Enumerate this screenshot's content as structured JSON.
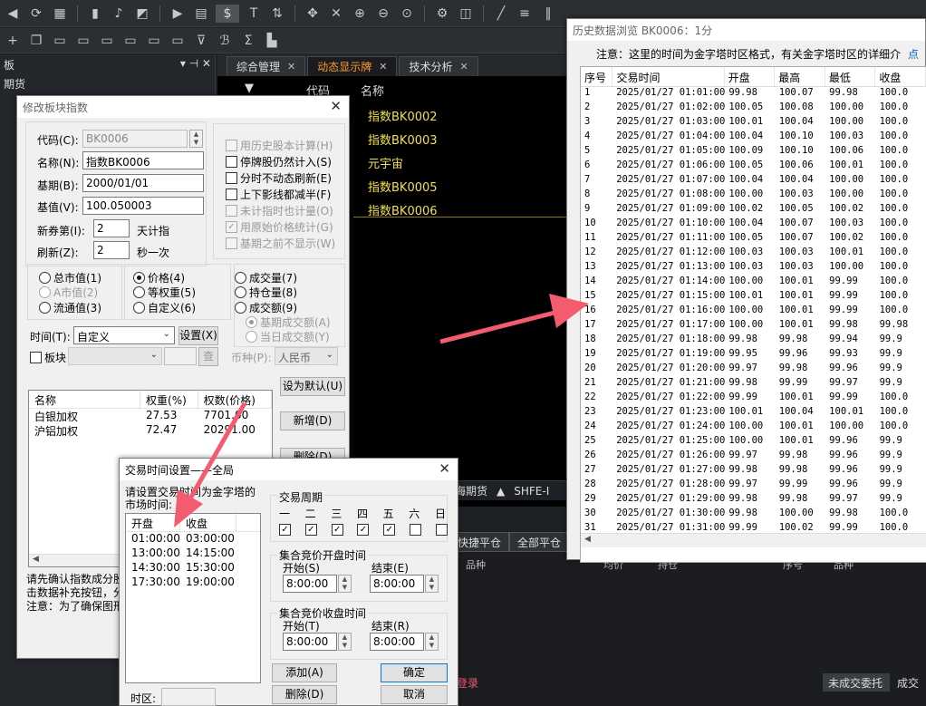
{
  "main": {
    "tabs": [
      {
        "label": "综合管理"
      },
      {
        "label": "动态显示牌"
      },
      {
        "label": "技术分析"
      }
    ],
    "left_panel": {
      "title": "板",
      "item": "期货"
    },
    "grid": {
      "col_code": "代码",
      "col_name": "名称",
      "rows": [
        "指数BK0002",
        "指数BK0003",
        "元宇宙",
        "指数BK0005",
        "指数BK0006"
      ]
    },
    "bottom": {
      "haiqi": "海期货",
      "shfe": "SHFE-I"
    },
    "buttons": {
      "quick_close": "快捷平仓",
      "close_all": "全部平仓"
    },
    "mid_headers": {
      "pinzhong": "品种",
      "xuhao": "序号",
      "pinzhong2": "品种",
      "junjia": "均价",
      "chicang": "持仓"
    },
    "bottom_tabs": {
      "unfilled": "未成交委托",
      "filled": "成交",
      "login": "登录"
    }
  },
  "modify_dialog": {
    "title": "修改板块指数",
    "code_label": "代码(C):",
    "code_value": "BK0006",
    "name_label": "名称(N):",
    "name_value": "指数BK0006",
    "base_date_label": "基期(B):",
    "base_date_value": "2000/01/01",
    "base_value_label": "基值(V):",
    "base_value_value": "100.050003",
    "new_label": "新券第(I):",
    "new_value": "2",
    "new_suffix": "天计指",
    "refresh_label": "刷新(Z):",
    "refresh_value": "2",
    "refresh_suffix": "秒一次",
    "options": [
      {
        "label": "用历史股本计算(H)",
        "checked": false,
        "disabled": true
      },
      {
        "label": "停牌股仍然计入(S)",
        "checked": false,
        "disabled": false
      },
      {
        "label": "分时不动态刷新(E)",
        "checked": false,
        "disabled": false
      },
      {
        "label": "上下影线都减半(F)",
        "checked": false,
        "disabled": false
      },
      {
        "label": "未计指时也计量(O)",
        "checked": false,
        "disabled": true
      },
      {
        "label": "用原始价格统计(G)",
        "checked": true,
        "disabled": true
      },
      {
        "label": "基期之前不显示(W)",
        "checked": false,
        "disabled": true
      }
    ],
    "weight_group1": [
      {
        "label": "总市值(1)",
        "on": false,
        "disabled": false
      },
      {
        "label": "A市值(2)",
        "on": false,
        "disabled": true
      },
      {
        "label": "流通值(3)",
        "on": false,
        "disabled": false
      }
    ],
    "weight_group2": [
      {
        "label": "价格(4)",
        "on": true
      },
      {
        "label": "等权重(5)",
        "on": false
      },
      {
        "label": "自定义(6)",
        "on": false
      }
    ],
    "weight_group3": [
      {
        "label": "成交量(7)",
        "on": false,
        "disabled": false
      },
      {
        "label": "持仓量(8)",
        "on": false,
        "disabled": false
      },
      {
        "label": "成交额(9)",
        "on": false,
        "disabled": false
      },
      {
        "label": "基期成交额(A)",
        "on": true,
        "disabled": true
      },
      {
        "label": "当日成交额(Y)",
        "on": false,
        "disabled": true
      }
    ],
    "time_label": "时间(T):",
    "time_value": "自定义",
    "settings_button": "设置(X)",
    "block_label": "板块",
    "query_button": "查",
    "currency_label": "币种(P):",
    "currency_value": "人民币",
    "set_default_button": "设为默认(U)",
    "add_button": "新增(D)",
    "delete_button": "删除(D)",
    "list_headers": [
      "名称",
      "权重(%)",
      "权数(价格)"
    ],
    "list_rows": [
      {
        "name": "白银加权",
        "weight": "27.53",
        "value": "7701.00"
      },
      {
        "name": "沪铝加权",
        "weight": "72.47",
        "value": "20291.00"
      }
    ],
    "note_lines": [
      "请先确认指数成分股",
      "击数据补充按钮，分",
      "注意：为了确保图形"
    ]
  },
  "trade_time_dialog": {
    "title": "交易时间设置——全局",
    "instruction": "请设置交易时间为金字塔的\n市场时间:",
    "headers": [
      "开盘",
      "收盘"
    ],
    "rows": [
      {
        "open": "01:00:00",
        "close": "03:00:00"
      },
      {
        "open": "13:00:00",
        "close": "14:15:00"
      },
      {
        "open": "14:30:00",
        "close": "15:30:00"
      },
      {
        "open": "17:30:00",
        "close": "19:00:00"
      }
    ],
    "timezone_label": "时区:",
    "cycle_label": "交易周期",
    "weekdays": [
      {
        "label": "一",
        "checked": true
      },
      {
        "label": "二",
        "checked": true
      },
      {
        "label": "三",
        "checked": true
      },
      {
        "label": "四",
        "checked": true
      },
      {
        "label": "五",
        "checked": true
      },
      {
        "label": "六",
        "checked": false
      },
      {
        "label": "日",
        "checked": false
      }
    ],
    "auction_open": {
      "title": "集合竞价开盘时间",
      "start_label": "开始(S)",
      "start_value": "8:00:00",
      "end_label": "结束(E)",
      "end_value": "8:00:00"
    },
    "auction_close": {
      "title": "集合竞价收盘时间",
      "start_label": "开始(T)",
      "start_value": "8:00:00",
      "end_label": "结束(R)",
      "end_value": "8:00:00"
    },
    "add_button": "添加(A)",
    "delete_button": "删除(D)",
    "ok_button": "确定",
    "cancel_button": "取消"
  },
  "history_window": {
    "title": "历史数据浏览 BK0006：1分",
    "note": "注意：这里的时间为金字塔时区格式，有关金字塔时区的详细介",
    "note_link": "点",
    "headers": [
      "序号",
      "交易时间",
      "开盘",
      "最高",
      "最低",
      "收盘"
    ],
    "rows": [
      [
        "1",
        "2025/01/27 01:01:00",
        "99.98",
        "100.07",
        "99.98",
        "100.0"
      ],
      [
        "2",
        "2025/01/27 01:02:00",
        "100.05",
        "100.08",
        "100.00",
        "100.0"
      ],
      [
        "3",
        "2025/01/27 01:03:00",
        "100.01",
        "100.04",
        "100.00",
        "100.0"
      ],
      [
        "4",
        "2025/01/27 01:04:00",
        "100.04",
        "100.10",
        "100.03",
        "100.0"
      ],
      [
        "5",
        "2025/01/27 01:05:00",
        "100.09",
        "100.10",
        "100.06",
        "100.0"
      ],
      [
        "6",
        "2025/01/27 01:06:00",
        "100.05",
        "100.06",
        "100.01",
        "100.0"
      ],
      [
        "7",
        "2025/01/27 01:07:00",
        "100.04",
        "100.04",
        "100.00",
        "100.0"
      ],
      [
        "8",
        "2025/01/27 01:08:00",
        "100.00",
        "100.03",
        "100.00",
        "100.0"
      ],
      [
        "9",
        "2025/01/27 01:09:00",
        "100.02",
        "100.05",
        "100.02",
        "100.0"
      ],
      [
        "10",
        "2025/01/27 01:10:00",
        "100.04",
        "100.07",
        "100.03",
        "100.0"
      ],
      [
        "11",
        "2025/01/27 01:11:00",
        "100.05",
        "100.07",
        "100.02",
        "100.0"
      ],
      [
        "12",
        "2025/01/27 01:12:00",
        "100.03",
        "100.03",
        "100.01",
        "100.0"
      ],
      [
        "13",
        "2025/01/27 01:13:00",
        "100.03",
        "100.03",
        "100.00",
        "100.0"
      ],
      [
        "14",
        "2025/01/27 01:14:00",
        "100.00",
        "100.01",
        "99.99",
        "100.0"
      ],
      [
        "15",
        "2025/01/27 01:15:00",
        "100.01",
        "100.01",
        "99.99",
        "100.0"
      ],
      [
        "16",
        "2025/01/27 01:16:00",
        "100.00",
        "100.01",
        "99.99",
        "100.0"
      ],
      [
        "17",
        "2025/01/27 01:17:00",
        "100.00",
        "100.01",
        "99.98",
        "99.98"
      ],
      [
        "18",
        "2025/01/27 01:18:00",
        "99.98",
        "99.98",
        "99.94",
        "99.9"
      ],
      [
        "19",
        "2025/01/27 01:19:00",
        "99.95",
        "99.96",
        "99.93",
        "99.9"
      ],
      [
        "20",
        "2025/01/27 01:20:00",
        "99.97",
        "99.98",
        "99.96",
        "99.9"
      ],
      [
        "21",
        "2025/01/27 01:21:00",
        "99.98",
        "99.99",
        "99.97",
        "99.9"
      ],
      [
        "22",
        "2025/01/27 01:22:00",
        "99.99",
        "100.01",
        "99.99",
        "100.0"
      ],
      [
        "23",
        "2025/01/27 01:23:00",
        "100.01",
        "100.04",
        "100.01",
        "100.0"
      ],
      [
        "24",
        "2025/01/27 01:24:00",
        "100.00",
        "100.01",
        "100.00",
        "100.0"
      ],
      [
        "25",
        "2025/01/27 01:25:00",
        "100.00",
        "100.01",
        "99.96",
        "99.9"
      ],
      [
        "26",
        "2025/01/27 01:26:00",
        "99.97",
        "99.98",
        "99.96",
        "99.9"
      ],
      [
        "27",
        "2025/01/27 01:27:00",
        "99.98",
        "99.98",
        "99.96",
        "99.9"
      ],
      [
        "28",
        "2025/01/27 01:28:00",
        "99.97",
        "99.99",
        "99.96",
        "99.9"
      ],
      [
        "29",
        "2025/01/27 01:29:00",
        "99.98",
        "99.98",
        "99.97",
        "99.9"
      ],
      [
        "30",
        "2025/01/27 01:30:00",
        "99.98",
        "100.00",
        "99.98",
        "100.0"
      ],
      [
        "31",
        "2025/01/27 01:31:00",
        "99.99",
        "100.02",
        "99.99",
        "100.0"
      ]
    ]
  },
  "colors": {
    "accent_orange": "#ff9a2e",
    "grid_yellow": "#f0e04a",
    "arrow_red": "#f25c6e"
  }
}
